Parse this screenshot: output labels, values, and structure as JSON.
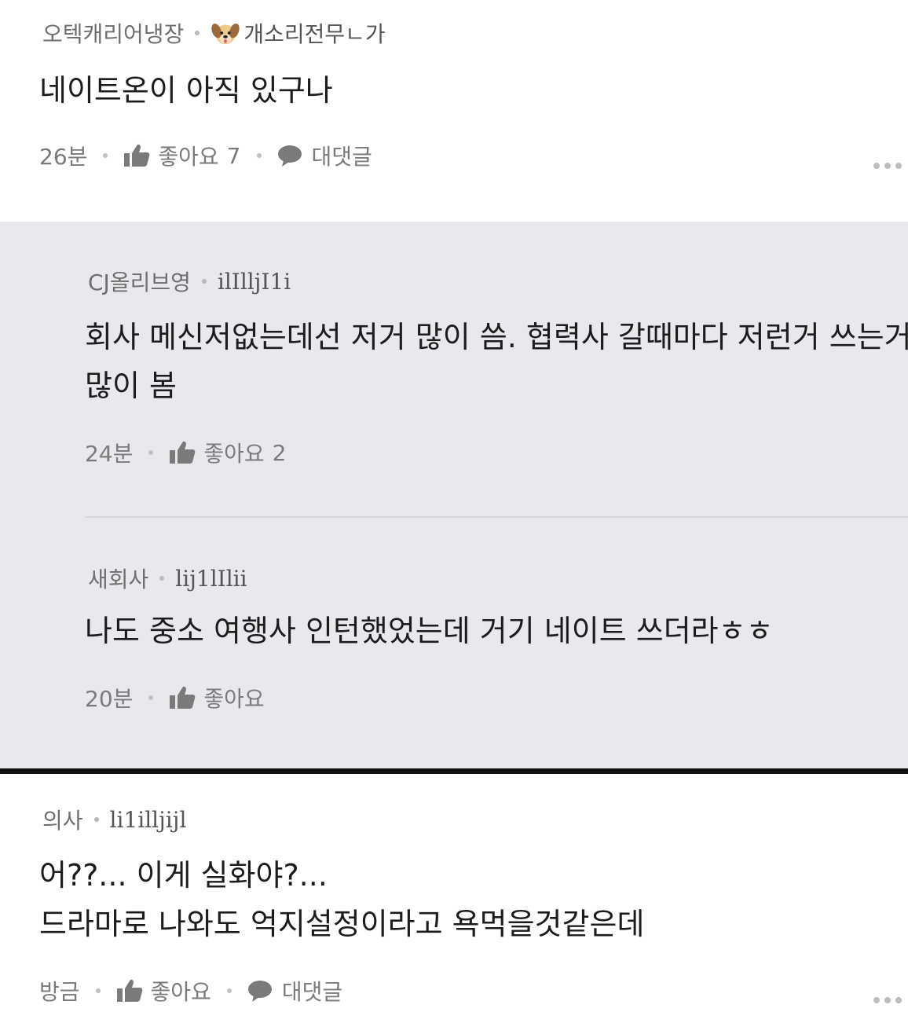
{
  "comments": [
    {
      "author": "오텍캐리어냉장",
      "nickname": "개소리전무ㄴ가",
      "avatar_icon": "dog-face-icon",
      "text": "네이트온이 아직 있구나",
      "time": "26분",
      "like_label": "좋아요",
      "like_count": "7",
      "reply_label": "대댓글"
    },
    {
      "author": "CJ올리브영",
      "nickname": "ilIlljI1i",
      "text_lines": [
        "회사 메신저없는데선 저거 많이 씀. 협력사 갈때마다 저런거 쓰는거",
        "많이 봄"
      ],
      "time": "24분",
      "like_label": "좋아요",
      "like_count": "2"
    },
    {
      "author": "새회사",
      "nickname": "lij1lIlii",
      "text": "나도 중소 여행사 인턴했었는데 거기 네이트 쓰더라ㅎㅎ",
      "time": "20분",
      "like_label": "좋아요"
    },
    {
      "author": "의사",
      "nickname": "li1illjijl",
      "text_lines": [
        "어??... 이게 실화야?...",
        "드라마로 나와도 억지설정이라고 욕먹을것같은데"
      ],
      "time": "방금",
      "like_label": "좋아요",
      "reply_label": "대댓글"
    }
  ],
  "colors": {
    "reply_bg": "#e8e9ec",
    "text": "#1c1c1c",
    "meta": "#6e6e6e"
  }
}
